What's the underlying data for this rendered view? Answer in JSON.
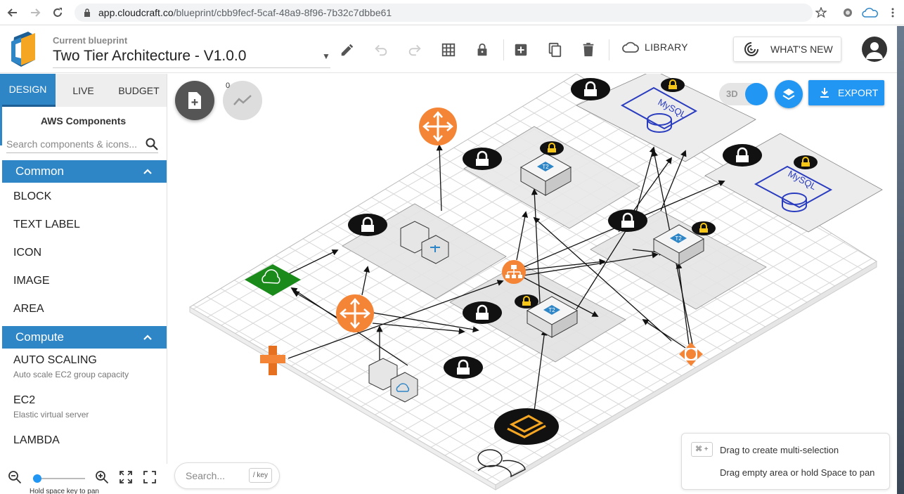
{
  "browser": {
    "url_host": "app.cloudcraft.co",
    "url_path": "/blueprint/cbb9fecf-5caf-48a9-8f96-7b32c7dbbe61"
  },
  "header": {
    "blueprint_label": "Current blueprint",
    "blueprint_title": "Two Tier Architecture - V1.0.0",
    "library_label": "LIBRARY",
    "whats_new_label": "WHAT'S NEW"
  },
  "sidebar": {
    "tabs": [
      {
        "label": "DESIGN",
        "active": true
      },
      {
        "label": "LIVE",
        "active": false
      },
      {
        "label": "BUDGET",
        "active": false
      }
    ],
    "title": "AWS Components",
    "search_placeholder": "Search components & icons...",
    "sections": [
      {
        "label": "Common",
        "items": [
          "BLOCK",
          "TEXT LABEL",
          "ICON",
          "IMAGE",
          "AREA"
        ]
      },
      {
        "label": "Compute",
        "items": [
          {
            "title": "AUTO SCALING",
            "subtitle": "Auto scale EC2 group capacity"
          },
          {
            "title": "EC2",
            "subtitle": "Elastic virtual server"
          },
          {
            "title": "LAMBDA",
            "subtitle": ""
          }
        ]
      }
    ],
    "zoom_hint": "Hold space key to pan",
    "zoom_level": 0.08
  },
  "canvas": {
    "trend_count": "0",
    "toggle_label": "3D",
    "export_label": "EXPORT",
    "search_placeholder": "Search...",
    "search_key": "/ key",
    "hint_kbd": "⌘ +",
    "hint_1": "Drag to create multi-selection",
    "hint_2": "Drag empty area or hold Space to pan",
    "db_label": "MySQL",
    "ec2_label": "T2"
  },
  "colors": {
    "accent": "#2f86c6",
    "action_blue": "#2196f3",
    "aws_orange": "#f58536",
    "vpc_green": "#1a8a1a"
  }
}
